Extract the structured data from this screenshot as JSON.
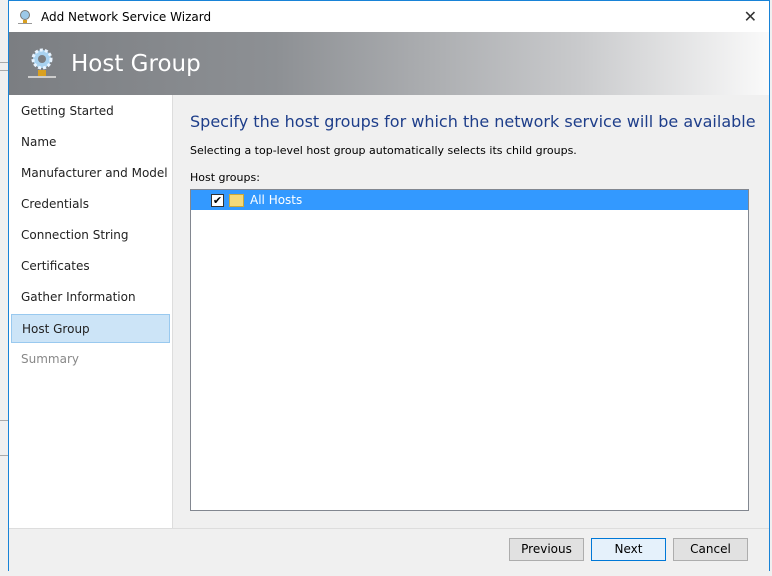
{
  "window": {
    "title": "Add Network Service Wizard",
    "close": "✕"
  },
  "banner": {
    "title": "Host Group"
  },
  "nav": {
    "items": [
      {
        "label": "Getting Started",
        "state": "normal"
      },
      {
        "label": "Name",
        "state": "normal"
      },
      {
        "label": "Manufacturer and Model",
        "state": "normal"
      },
      {
        "label": "Credentials",
        "state": "normal"
      },
      {
        "label": "Connection String",
        "state": "normal"
      },
      {
        "label": "Certificates",
        "state": "normal"
      },
      {
        "label": "Gather Information",
        "state": "normal"
      },
      {
        "label": "Host Group",
        "state": "selected"
      },
      {
        "label": "Summary",
        "state": "disabled"
      }
    ]
  },
  "main": {
    "heading": "Specify the host groups for which the network service will be available",
    "description": "Selecting a top-level host group automatically selects its child groups.",
    "tree_label": "Host groups:",
    "tree": [
      {
        "label": "All Hosts",
        "checked": true,
        "selected": true,
        "check": "✔"
      }
    ]
  },
  "footer": {
    "previous": "Previous",
    "next": "Next",
    "cancel": "Cancel"
  },
  "colors": {
    "accent": "#3399ff",
    "heading": "#1e3e8a",
    "nav_selected": "#cce4f7"
  }
}
